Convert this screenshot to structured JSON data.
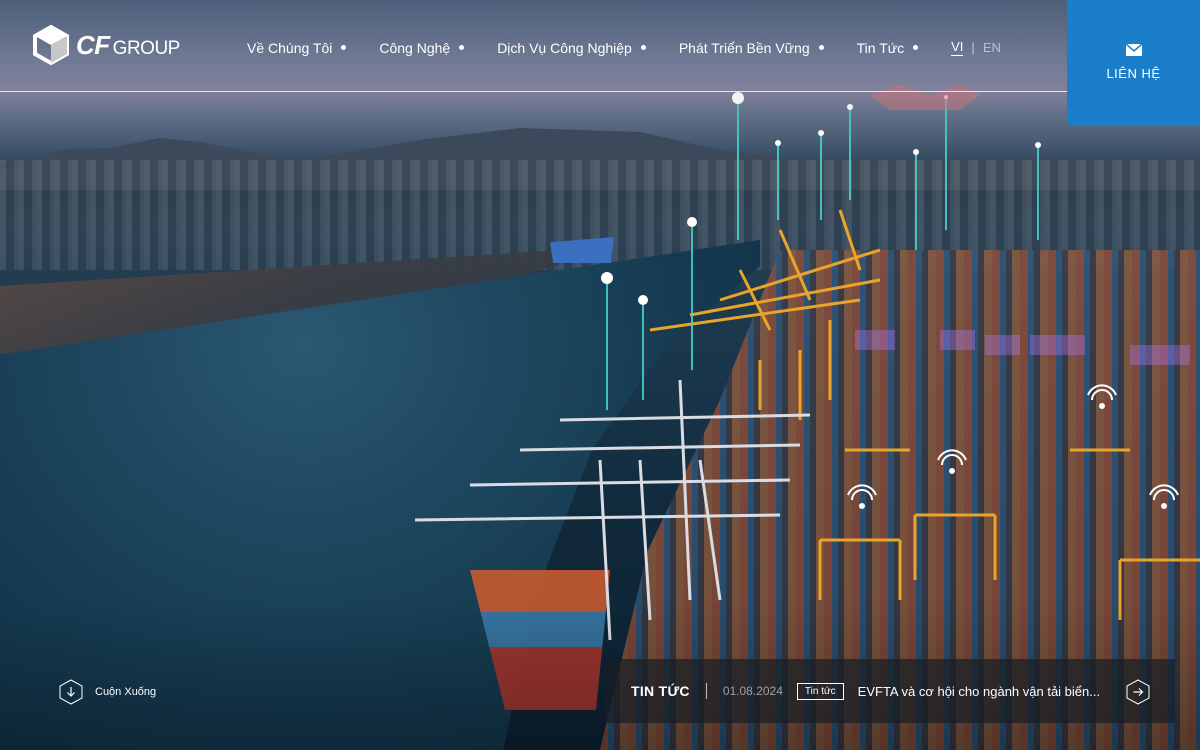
{
  "brand": {
    "mark": "CF",
    "name": "GROUP"
  },
  "nav": {
    "items": [
      {
        "label": "Về Chúng Tôi"
      },
      {
        "label": "Công Nghệ"
      },
      {
        "label": "Dịch Vụ Công Nghiệp"
      },
      {
        "label": "Phát Triển Bền Vững"
      },
      {
        "label": "Tin Tức"
      }
    ],
    "lang_vi": "VI",
    "lang_sep": "|",
    "lang_en": "EN"
  },
  "contact": {
    "label": "LIÊN HỆ",
    "icon": "mail-icon",
    "color": "#1a7ec9"
  },
  "scroll": {
    "label": "Cuộn Xuống",
    "icon": "arrow-down-icon"
  },
  "news": {
    "title": "TIN TỨC",
    "date": "01.08.2024",
    "tag": "Tin tức",
    "headline": "EVFTA và cơ hội cho ngành vận tải biển...",
    "icon": "arrow-right-icon"
  },
  "hero": {
    "image": "aerial-container-port-night"
  }
}
